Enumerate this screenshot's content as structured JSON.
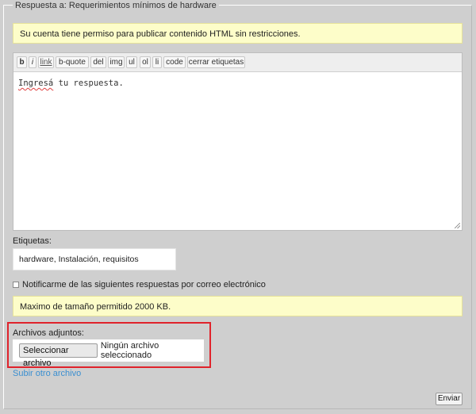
{
  "form": {
    "legend": "Respuesta a: Requerimientos mínimos de hardware",
    "html_permission_notice": "Su cuenta tiene permiso para publicar contenido HTML sin restricciones."
  },
  "toolbar": {
    "buttons": [
      "b",
      "i",
      "link",
      "b-quote",
      "del",
      "img",
      "ul",
      "ol",
      "li",
      "code",
      "cerrar etiquetas"
    ]
  },
  "editor": {
    "text_word1": "Ingresá",
    "text_rest": " tu respuesta."
  },
  "tags": {
    "label": "Etiquetas:",
    "value": "hardware, Instalación, requisitos"
  },
  "notify": {
    "label": "Notificarme de las siguientes respuestas por correo electrónico",
    "checked": false
  },
  "upload": {
    "max_size_notice": "Maximo de tamaño permitido 2000 KB.",
    "label": "Archivos adjuntos:",
    "select_button": "Seleccionar archivo",
    "status": "Ningún archivo seleccionado",
    "add_another": "Subir otro archivo"
  },
  "actions": {
    "submit": "Enviar"
  },
  "colors": {
    "background": "#cfcfcf",
    "notice_bg": "#fdfdc9",
    "highlight": "#e0232b",
    "link": "#3b8fd0"
  }
}
